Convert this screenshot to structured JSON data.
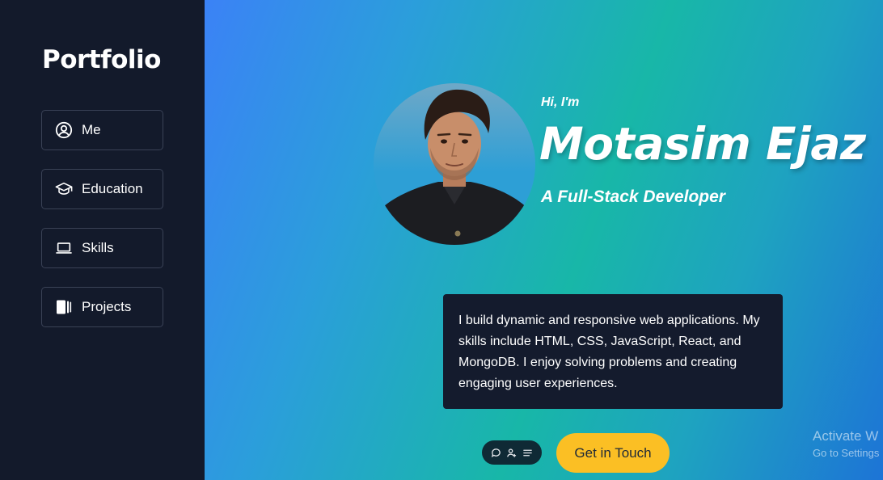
{
  "sidebar": {
    "brand": "Portfolio",
    "items": [
      {
        "label": "Me",
        "icon": "user-circle-icon"
      },
      {
        "label": "Education",
        "icon": "graduation-cap-icon"
      },
      {
        "label": "Skills",
        "icon": "laptop-icon"
      },
      {
        "label": "Projects",
        "icon": "book-icon"
      }
    ]
  },
  "hero": {
    "greeting": "Hi, I'm",
    "name": "Motasim Ejaz",
    "role": "A Full-Stack Developer",
    "about": "I build dynamic and responsive web applications. My skills include HTML, CSS, JavaScript, React, and MongoDB. I enjoy solving problems and creating engaging user experiences.",
    "cta_label": "Get in Touch"
  },
  "toolbar": {
    "icons": [
      "chat-bubble-icon",
      "add-user-icon",
      "menu-lines-icon"
    ]
  },
  "watermark": {
    "line1": "Activate W",
    "line2": "Go to Settings"
  },
  "colors": {
    "sidebar_bg": "#131a2b",
    "card_bg": "#141b2d",
    "accent_yellow": "#fbbf24",
    "gradient_start": "#3b82f6",
    "gradient_mid": "#18b7a8",
    "gradient_end": "#1d74d6"
  }
}
